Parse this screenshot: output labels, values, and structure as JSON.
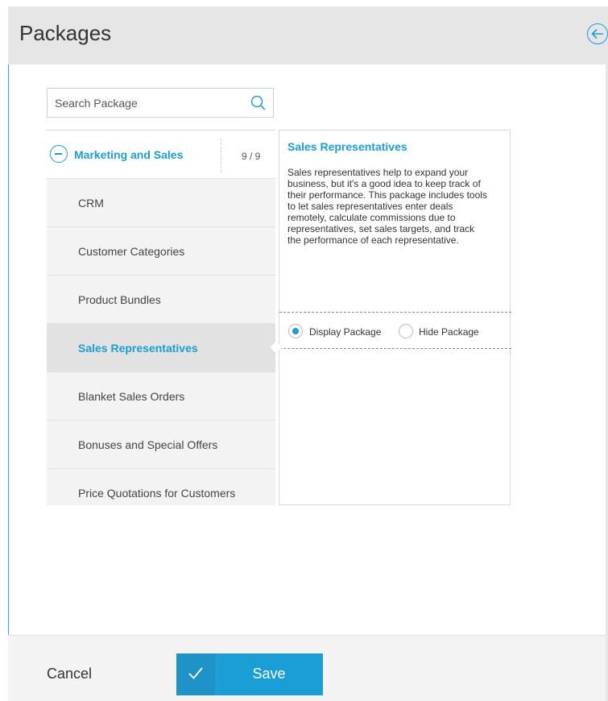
{
  "header": {
    "title": "Packages",
    "back_icon": "arrow-left-circle-icon"
  },
  "search": {
    "placeholder": "Search Package",
    "value": "",
    "icon": "search-icon"
  },
  "group": {
    "label": "Marketing and Sales",
    "count": "9 / 9",
    "icon": "collapse-minus-icon"
  },
  "items": [
    {
      "label": "CRM",
      "active": false
    },
    {
      "label": "Customer Categories",
      "active": false
    },
    {
      "label": "Product Bundles",
      "active": false
    },
    {
      "label": "Sales Representatives",
      "active": true
    },
    {
      "label": "Blanket Sales Orders",
      "active": false
    },
    {
      "label": "Bonuses and Special Offers",
      "active": false
    },
    {
      "label": "Price Quotations for Customers",
      "active": false
    }
  ],
  "detail": {
    "title": "Sales Representatives",
    "description": "Sales representatives help to expand your business, but it's a good idea to keep track of their performance. This package includes tools to let sales representatives enter deals remotely, calculate commissions due to representatives, set sales targets, and track the performance of each representative.",
    "options": [
      {
        "label": "Display Package",
        "checked": true
      },
      {
        "label": "Hide Package",
        "checked": false
      }
    ]
  },
  "footer": {
    "cancel_label": "Cancel",
    "save_label": "Save"
  },
  "colors": {
    "accent": "#1b9ed6",
    "header_bg": "#e6e6e6",
    "item_bg": "#f3f3f3",
    "active_bg": "#e2e2e2"
  }
}
